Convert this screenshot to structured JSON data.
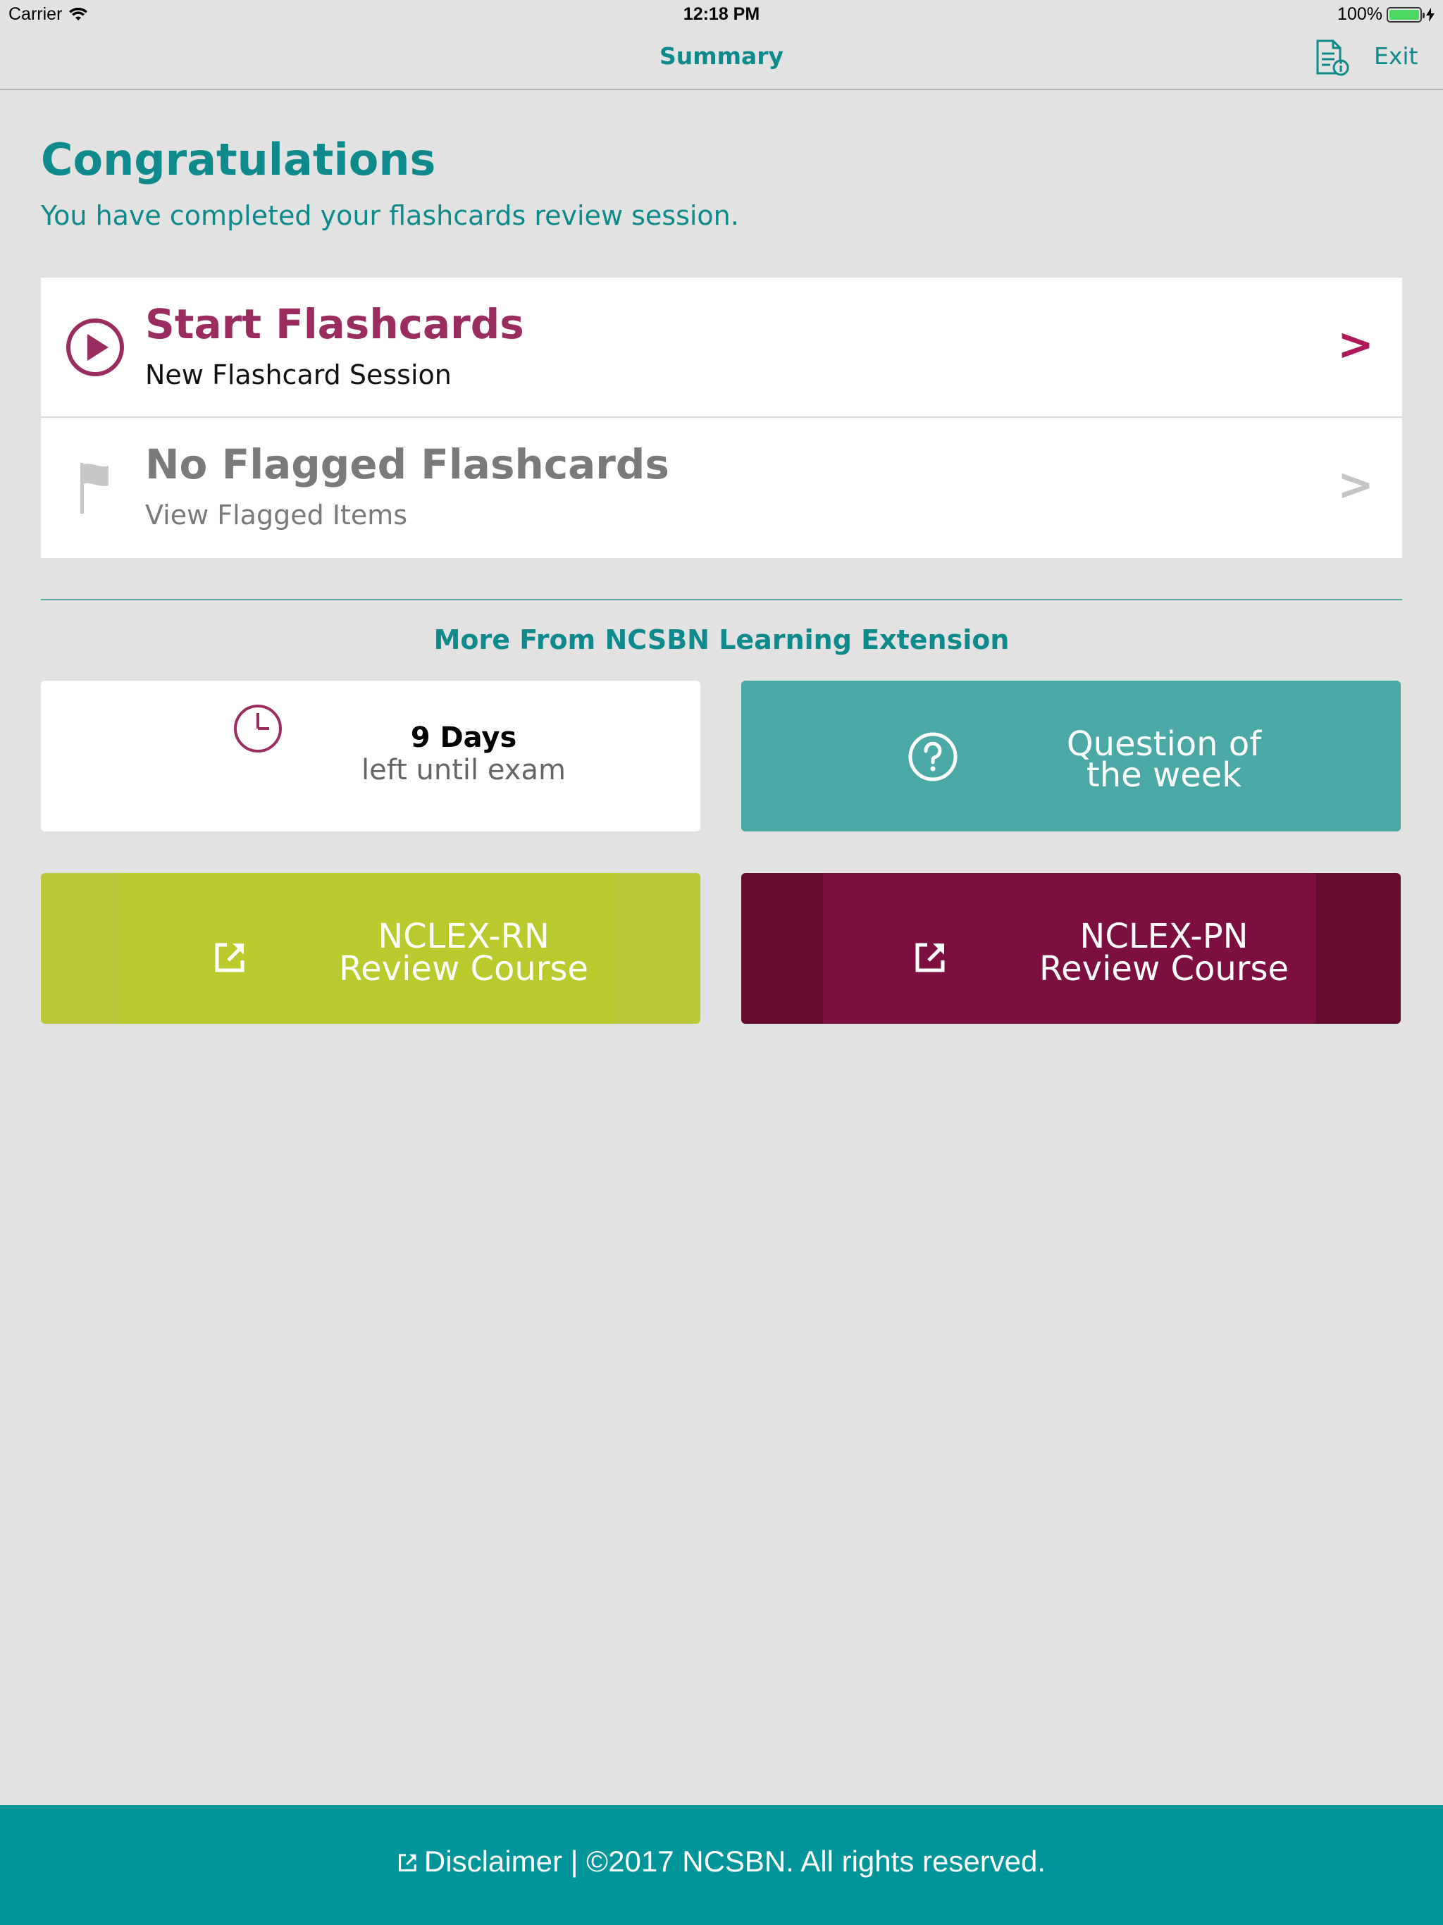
{
  "status_bar": {
    "carrier": "Carrier",
    "time": "12:18 PM",
    "battery": "100%",
    "battery_level": 1.0
  },
  "nav": {
    "title": "Summary",
    "exit_label": "Exit",
    "doc_icon": "document-info-icon"
  },
  "header": {
    "title": "Congratulations",
    "subtitle": "You have completed your flashcards review session."
  },
  "actions": [
    {
      "title": "Start Flashcards",
      "subtitle": "New Flashcard Session",
      "icon": "play-circle-icon",
      "chevron": ">",
      "title_color": "#9b2c5f"
    },
    {
      "title": "No Flagged Flashcards",
      "subtitle": "View Flagged Items",
      "icon": "flag-icon",
      "chevron": ">",
      "title_color": "#7a7a7a"
    }
  ],
  "more": {
    "heading": "More From NCSBN Learning Extension",
    "countdown": {
      "value": "9 Days",
      "label": "left until exam",
      "icon": "clock-icon"
    },
    "qotw": {
      "line1": "Question of",
      "line2": "the week",
      "icon": "question-circle-icon"
    },
    "rn": {
      "line1": "NCLEX-RN",
      "line2": "Review Course",
      "icon": "external-link-icon"
    },
    "pn": {
      "line1": "NCLEX-PN",
      "line2": "Review Course",
      "icon": "external-link-icon"
    }
  },
  "footer": {
    "text": "Disclaimer | ©2017 NCSBN. All rights reserved.",
    "icon": "external-link-icon"
  },
  "colors": {
    "teal": "#0e8a8c",
    "magenta": "#9b2c5f",
    "lime": "#bac92b",
    "maroon": "#7c0f40",
    "footer": "#00959a"
  }
}
